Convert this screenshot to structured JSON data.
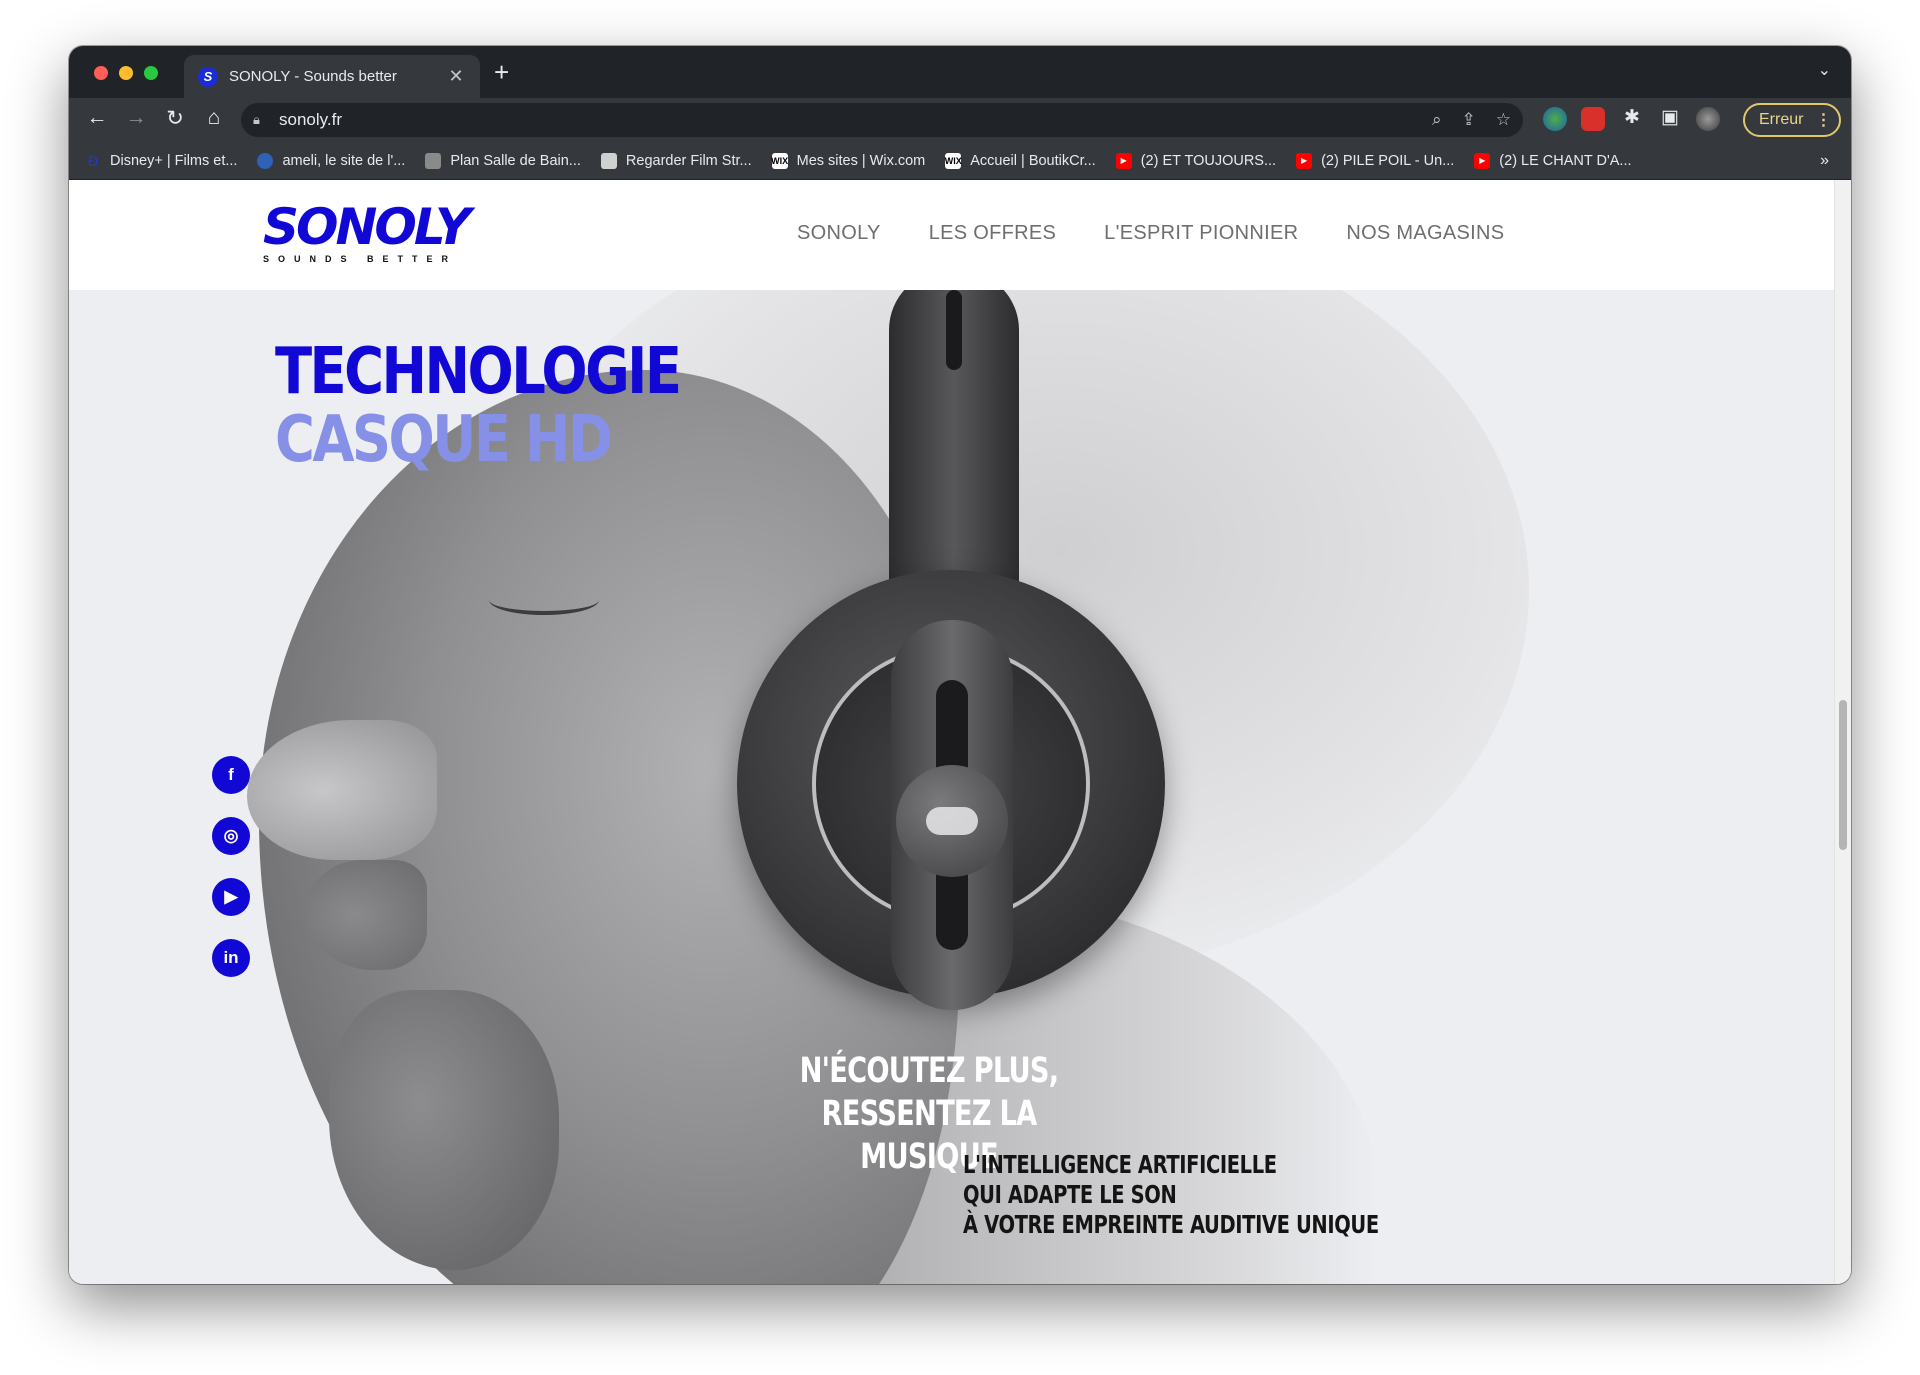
{
  "browser": {
    "tab_title": "SONOLY - Sounds better",
    "tab_favicon_letter": "S",
    "new_tab_symbol": "+",
    "url": "sonoly.fr",
    "profile_label": "Erreur",
    "bookmarks": [
      {
        "label": "Disney+ | Films et...",
        "color": "#1a3adb"
      },
      {
        "label": "ameli, le site de l'...",
        "color": "#2d62b8"
      },
      {
        "label": "Plan Salle de Bain...",
        "color": "#8a8a8a"
      },
      {
        "label": "Regarder Film Str...",
        "color": "#a0a0a0"
      },
      {
        "label": "Mes sites | Wix.com",
        "color": "#ffffff"
      },
      {
        "label": "Accueil | BoutikCr...",
        "color": "#ffffff"
      },
      {
        "label": "(2) ET TOUJOURS...",
        "color": "#ff0000"
      },
      {
        "label": "(2) PILE POIL - Un...",
        "color": "#ff0000"
      },
      {
        "label": "(2) LE CHANT D'A...",
        "color": "#ff0000"
      }
    ],
    "bookmarks_more": "»"
  },
  "site": {
    "logo_text": "SONOLY",
    "logo_tagline": "SOUNDS BETTER",
    "brand_color": "#1208d6",
    "menu": [
      "SONOLY",
      "LES OFFRES",
      "L'ESPRIT PIONNIER",
      "NOS MAGASINS"
    ],
    "hero": {
      "title_line1": "TECHNOLOGIE",
      "title_line2": "CASQUE HD",
      "tagline_line1": "N'ÉCOUTEZ PLUS,",
      "tagline_line2": "RESSENTEZ LA MUSIQUE",
      "sub_line1": "L'INTELLIGENCE ARTIFICIELLE",
      "sub_line2": "QUI ADAPTE LE SON",
      "sub_line3": "À VOTRE EMPREINTE AUDITIVE UNIQUE"
    },
    "social": [
      "facebook-icon",
      "instagram-icon",
      "youtube-icon",
      "linkedin-icon"
    ]
  }
}
